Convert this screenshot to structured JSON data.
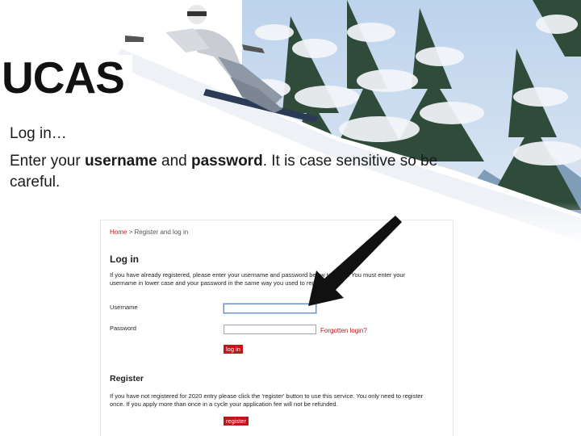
{
  "logo": {
    "text": "UCAS"
  },
  "slide": {
    "title": "Log in…",
    "instructions": {
      "part1": "Enter your ",
      "username_word": "username",
      "part2": " and ",
      "password_word": "password",
      "part3": ". It is case sensitive so be careful."
    }
  },
  "page": {
    "breadcrumb": {
      "home": "Home",
      "separator": " > ",
      "current": "Register and log in"
    },
    "login": {
      "heading": "Log in",
      "instructions": "If you have already registered, please enter your username and password below to log in. You must enter your username in lower case and your password in the same way you used to register.",
      "username_label": "Username",
      "password_label": "Password",
      "forgotten_link": "Forgotten login?",
      "login_button": "log in"
    },
    "register": {
      "heading": "Register",
      "instructions": "If you have not registered for 2020 entry please click the 'register' button to use this service. You only need to register once. If you apply more than once in a cycle your application fee will not be refunded.",
      "register_button": "register"
    }
  },
  "colors": {
    "accent_red": "#c0151b",
    "sky": "#9fc1e3",
    "snow": "#f3f5f9"
  }
}
